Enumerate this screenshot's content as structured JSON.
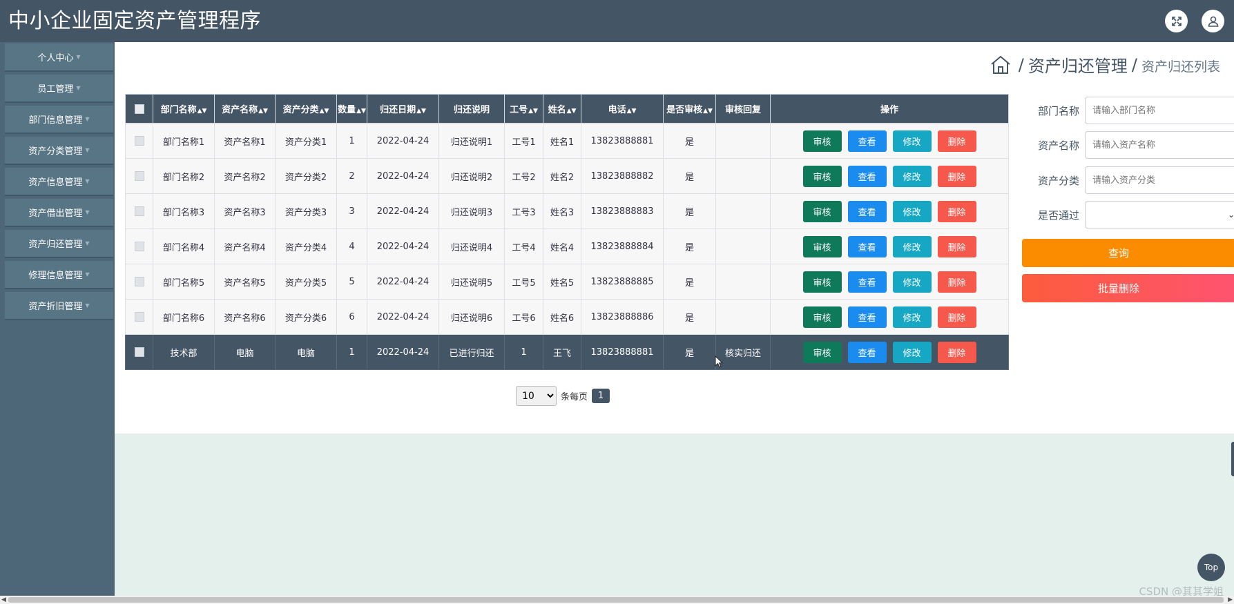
{
  "header": {
    "title": "中小企业固定资产管理程序",
    "icons": [
      "fullscreen-icon",
      "user-icon"
    ]
  },
  "sidebar": {
    "items": [
      {
        "label": "个人中心"
      },
      {
        "label": "员工管理"
      },
      {
        "label": "部门信息管理"
      },
      {
        "label": "资产分类管理"
      },
      {
        "label": "资产信息管理"
      },
      {
        "label": "资产借出管理"
      },
      {
        "label": "资产归还管理"
      },
      {
        "label": "修理信息管理"
      },
      {
        "label": "资产折旧管理"
      }
    ]
  },
  "breadcrumb": {
    "sep": "/",
    "main": "资产归还管理",
    "sub": "资产归还列表"
  },
  "table": {
    "headers": [
      "部门名称",
      "资产名称",
      "资产分类",
      "数量",
      "归还日期",
      "归还说明",
      "工号",
      "姓名",
      "电话",
      "是否审核",
      "审核回复",
      "操作"
    ],
    "rows": [
      {
        "dept": "部门名称1",
        "asset": "资产名称1",
        "cat": "资产分类1",
        "qty": "1",
        "date": "2022-04-24",
        "note": "归还说明1",
        "no": "工号1",
        "name": "姓名1",
        "phone": "13823888881",
        "approved": "是",
        "reply": ""
      },
      {
        "dept": "部门名称2",
        "asset": "资产名称2",
        "cat": "资产分类2",
        "qty": "2",
        "date": "2022-04-24",
        "note": "归还说明2",
        "no": "工号2",
        "name": "姓名2",
        "phone": "13823888882",
        "approved": "是",
        "reply": ""
      },
      {
        "dept": "部门名称3",
        "asset": "资产名称3",
        "cat": "资产分类3",
        "qty": "3",
        "date": "2022-04-24",
        "note": "归还说明3",
        "no": "工号3",
        "name": "姓名3",
        "phone": "13823888883",
        "approved": "是",
        "reply": ""
      },
      {
        "dept": "部门名称4",
        "asset": "资产名称4",
        "cat": "资产分类4",
        "qty": "4",
        "date": "2022-04-24",
        "note": "归还说明4",
        "no": "工号4",
        "name": "姓名4",
        "phone": "13823888884",
        "approved": "是",
        "reply": ""
      },
      {
        "dept": "部门名称5",
        "asset": "资产名称5",
        "cat": "资产分类5",
        "qty": "5",
        "date": "2022-04-24",
        "note": "归还说明5",
        "no": "工号5",
        "name": "姓名5",
        "phone": "13823888885",
        "approved": "是",
        "reply": ""
      },
      {
        "dept": "部门名称6",
        "asset": "资产名称6",
        "cat": "资产分类6",
        "qty": "6",
        "date": "2022-04-24",
        "note": "归还说明6",
        "no": "工号6",
        "name": "姓名6",
        "phone": "13823888886",
        "approved": "是",
        "reply": ""
      },
      {
        "dept": "技术部",
        "asset": "电脑",
        "cat": "电脑",
        "qty": "1",
        "date": "2022-04-24",
        "note": "已进行归还",
        "no": "1",
        "name": "王飞",
        "phone": "13823888881",
        "approved": "是",
        "reply": "核实归还"
      }
    ],
    "actions": {
      "audit": "审核",
      "view": "查看",
      "edit": "修改",
      "delete": "删除"
    }
  },
  "pager": {
    "page_size": "10",
    "per_page_label": "条每页",
    "current_page": "1"
  },
  "search": {
    "dept_label": "部门名称",
    "dept_placeholder": "请输入部门名称",
    "asset_label": "资产名称",
    "asset_placeholder": "请输入资产名称",
    "cat_label": "资产分类",
    "cat_placeholder": "请输入资产分类",
    "pass_label": "是否通过",
    "pass_value": "",
    "query_label": "查询",
    "batch_delete_label": "批量删除"
  },
  "top_button": "Top",
  "watermark": "CSDN @其其学姐",
  "colors": {
    "header": "#445566",
    "audit": "#0f7a5a",
    "view": "#1a8cf0",
    "edit": "#16a7c4",
    "delete": "#f7584c",
    "query": "#fb8c00"
  }
}
